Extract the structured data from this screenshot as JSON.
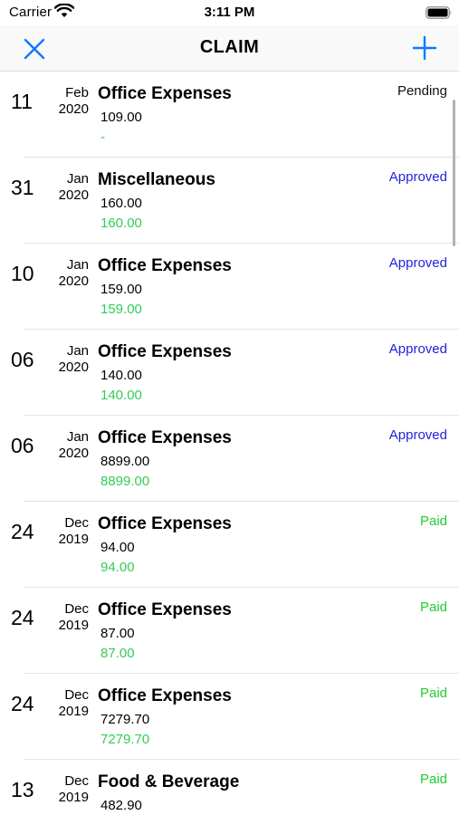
{
  "status_bar": {
    "carrier": "Carrier",
    "time": "3:11 PM"
  },
  "nav": {
    "title": "CLAIM",
    "close_icon": "close-icon",
    "add_icon": "plus-icon"
  },
  "colors": {
    "accent": "#0a7aff",
    "pending": "#111111",
    "approved": "#1f1fdd",
    "paid": "#22cc33",
    "approved_amount": "#33cc55"
  },
  "claims": [
    {
      "day": "11",
      "month": "Feb",
      "year": "2020",
      "category": "Office Expenses",
      "claimed": "109.00",
      "approved": "-",
      "status": "Pending"
    },
    {
      "day": "31",
      "month": "Jan",
      "year": "2020",
      "category": "Miscellaneous",
      "claimed": "160.00",
      "approved": "160.00",
      "status": "Approved"
    },
    {
      "day": "10",
      "month": "Jan",
      "year": "2020",
      "category": "Office Expenses",
      "claimed": "159.00",
      "approved": "159.00",
      "status": "Approved"
    },
    {
      "day": "06",
      "month": "Jan",
      "year": "2020",
      "category": "Office Expenses",
      "claimed": "140.00",
      "approved": "140.00",
      "status": "Approved"
    },
    {
      "day": "06",
      "month": "Jan",
      "year": "2020",
      "category": "Office Expenses",
      "claimed": "8899.00",
      "approved": "8899.00",
      "status": "Approved"
    },
    {
      "day": "24",
      "month": "Dec",
      "year": "2019",
      "category": "Office Expenses",
      "claimed": "94.00",
      "approved": "94.00",
      "status": "Paid"
    },
    {
      "day": "24",
      "month": "Dec",
      "year": "2019",
      "category": "Office Expenses",
      "claimed": "87.00",
      "approved": "87.00",
      "status": "Paid"
    },
    {
      "day": "24",
      "month": "Dec",
      "year": "2019",
      "category": "Office Expenses",
      "claimed": "7279.70",
      "approved": "7279.70",
      "status": "Paid"
    },
    {
      "day": "13",
      "month": "Dec",
      "year": "2019",
      "category": "Food & Beverage",
      "claimed": "482.90",
      "approved": "",
      "status": "Paid"
    }
  ]
}
